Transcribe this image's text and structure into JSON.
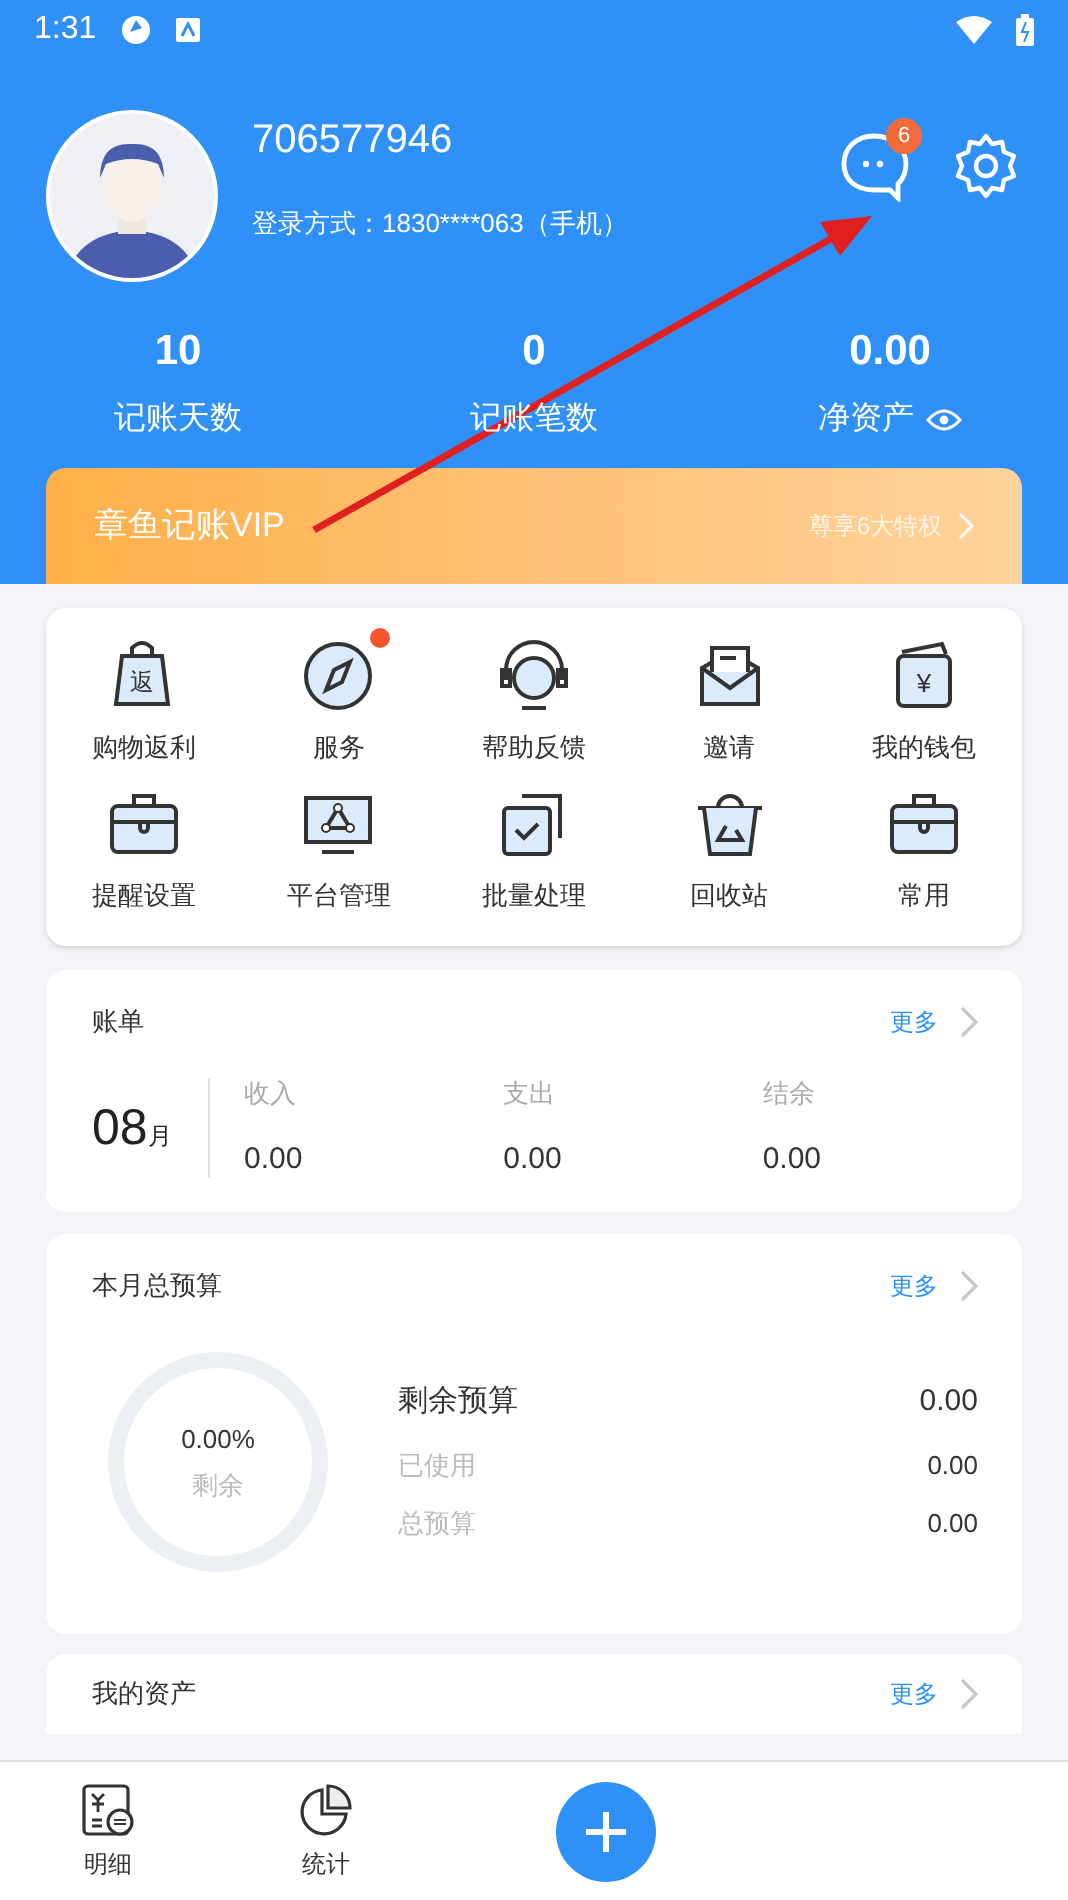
{
  "status_bar": {
    "time": "1:31"
  },
  "profile": {
    "user_id": "706577946",
    "login": "登录方式：1830****063（手机）",
    "message_count": "6"
  },
  "stats": [
    {
      "value": "10",
      "label": "记账天数"
    },
    {
      "value": "0",
      "label": "记账笔数"
    },
    {
      "value": "0.00",
      "label": "净资产",
      "eye": true
    }
  ],
  "vip_banner": {
    "title": "章鱼记账VIP",
    "link": "尊享6大特权"
  },
  "shortcuts": [
    {
      "label": "购物返利",
      "icon_text": "返",
      "notification": false
    },
    {
      "label": "服务",
      "notification": true
    },
    {
      "label": "帮助反馈",
      "notification": false
    },
    {
      "label": "邀请",
      "notification": false
    },
    {
      "label": "我的钱包",
      "icon_text": "¥",
      "notification": false
    },
    {
      "label": "提醒设置",
      "notification": false
    },
    {
      "label": "平台管理",
      "notification": false
    },
    {
      "label": "批量处理",
      "notification": false
    },
    {
      "label": "回收站",
      "notification": false
    },
    {
      "label": "常用",
      "notification": false
    }
  ],
  "bill_card": {
    "title": "账单",
    "more": "更多",
    "month": "08",
    "month_unit": "月",
    "columns": [
      {
        "label": "收入",
        "value": "0.00"
      },
      {
        "label": "支出",
        "value": "0.00"
      },
      {
        "label": "结余",
        "value": "0.00"
      }
    ]
  },
  "budget_card": {
    "title": "本月总预算",
    "more": "更多",
    "ring_percent": "0.00%",
    "ring_label": "剩余",
    "rows": [
      {
        "label": "剩余预算",
        "value": "0.00",
        "kind": "main"
      },
      {
        "label": "已使用",
        "value": "0.00",
        "kind": "sub"
      },
      {
        "label": "总预算",
        "value": "0.00",
        "kind": "sub"
      }
    ]
  },
  "assets_card": {
    "title": "我的资产",
    "more": "更多"
  },
  "bottom_nav": [
    {
      "label": "明细",
      "kind": "detail"
    },
    {
      "label": "统计",
      "kind": "stats"
    },
    {
      "kind": "add"
    }
  ]
}
